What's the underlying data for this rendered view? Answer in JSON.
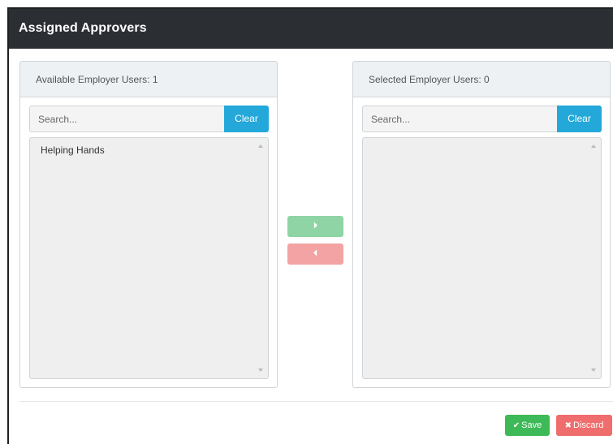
{
  "dialog": {
    "title": "Assigned Approvers"
  },
  "available": {
    "header": "Available Employer Users: 1",
    "search_placeholder": "Search...",
    "clear_label": "Clear",
    "items": [
      "Helping Hands"
    ]
  },
  "selected": {
    "header": "Selected Employer Users: 0",
    "search_placeholder": "Search...",
    "clear_label": "Clear",
    "items": []
  },
  "transfer": {
    "move_right_glyph": "⏵",
    "move_left_glyph": "⏴"
  },
  "footer": {
    "save_icon": "✔",
    "save_label": "Save",
    "discard_icon": "✖",
    "discard_label": "Discard"
  },
  "colors": {
    "header_bg": "#2b2e33",
    "clear_bg": "#23a8d9",
    "move_right_bg": "#8fd4a4",
    "move_left_bg": "#f3a3a3",
    "save_bg": "#3dba57",
    "discard_bg": "#ef6d6d"
  }
}
